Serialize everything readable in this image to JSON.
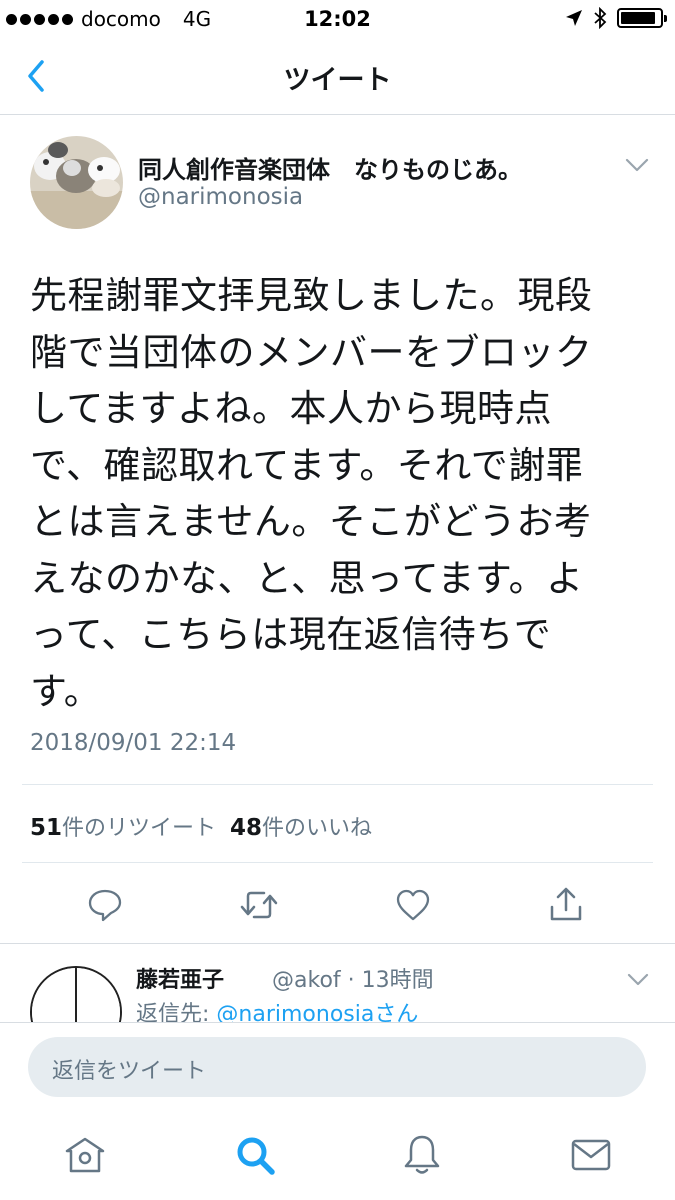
{
  "status_bar": {
    "carrier": "docomo",
    "network": "4G",
    "time": "12:02",
    "battery_level": 0.9
  },
  "nav": {
    "title": "ツイート",
    "back_icon": "chevron-left-icon"
  },
  "tweet": {
    "author_name": "同人創作音楽団体　なりものじあ。",
    "author_handle": "@narimonosia",
    "text_lines": [
      "先程謝罪文拝見致しました。現段",
      "階で当団体のメンバーをブロック",
      "してますよね。本人から現時点",
      "で、確認取れてます。それで謝罪",
      "とは言えません。そこがどうお考",
      "えなのかな、と、思ってます。よ",
      "って、こちらは現在返信待ちで",
      "す。"
    ],
    "timestamp": "2018/09/01 22:14",
    "retweet_count": "51",
    "retweet_label": "件のリツイート",
    "like_count": "48",
    "like_label": "件のいいね",
    "actions": [
      "reply-icon",
      "retweet-icon",
      "like-icon",
      "share-icon"
    ]
  },
  "reply": {
    "author_name": "藤若亜子",
    "meta": "@akof · 13時間",
    "reply_to_prefix": "返信先: ",
    "reply_to_mention": "@narimonosiaさん"
  },
  "compose": {
    "placeholder": "返信をツイート"
  },
  "tab_bar": {
    "tabs": [
      "home-icon",
      "search-icon",
      "notifications-icon",
      "messages-icon"
    ],
    "active": "search-icon"
  },
  "colors": {
    "accent": "#1da1f2",
    "secondary_text": "#657786",
    "icon_gray": "#657786",
    "compose_bg": "#e6ecf0"
  }
}
